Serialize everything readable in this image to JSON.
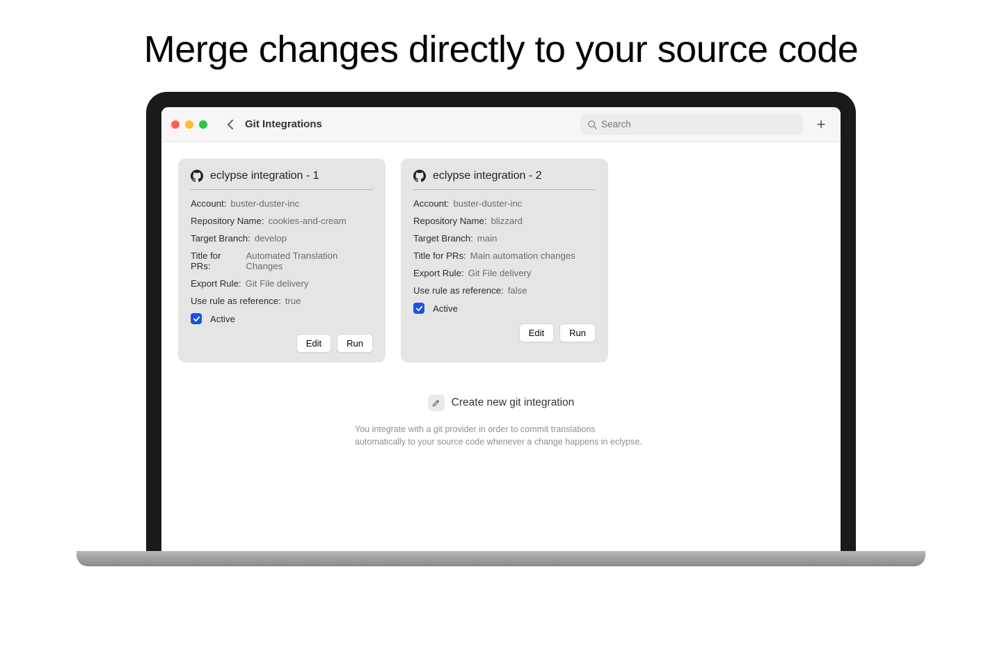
{
  "headline": "Merge changes directly to your source code",
  "toolbar": {
    "title": "Git Integrations",
    "search_placeholder": "Search"
  },
  "field_labels": {
    "account": "Account:",
    "repository_name": "Repository Name:",
    "target_branch": "Target Branch:",
    "title_for_prs": "Title for PRs:",
    "export_rule": "Export Rule:",
    "use_rule_as_reference": "Use rule as reference:",
    "active": "Active"
  },
  "cards": [
    {
      "title": "eclypse integration - 1",
      "account": "buster-duster-inc",
      "repository_name": "cookies-and-cream",
      "target_branch": "develop",
      "title_for_prs": "Automated Translation Changes",
      "export_rule": "Git File delivery",
      "use_rule_as_reference": "true",
      "active": true
    },
    {
      "title": "eclypse integration - 2",
      "account": "buster-duster-inc",
      "repository_name": "blizzard",
      "target_branch": "main",
      "title_for_prs": "Main automation changes",
      "export_rule": "Git File delivery",
      "use_rule_as_reference": "false",
      "active": true
    }
  ],
  "buttons": {
    "edit": "Edit",
    "run": "Run",
    "create": "Create new git integration"
  },
  "help_text": "You integrate with a git provider in order to commit translations automatically to your source code whenever a change happens in eclypse."
}
